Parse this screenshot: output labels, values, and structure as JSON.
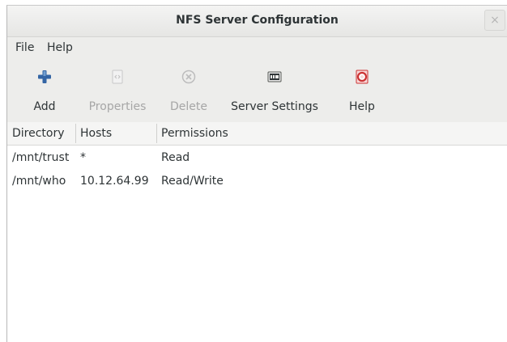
{
  "window": {
    "title": "NFS Server Configuration",
    "close_glyph": "×"
  },
  "menubar": {
    "items": [
      {
        "label": "File"
      },
      {
        "label": "Help"
      }
    ]
  },
  "toolbar": {
    "add": {
      "label": "Add",
      "icon": "plus-icon",
      "enabled": true
    },
    "properties": {
      "label": "Properties",
      "icon": "properties-icon",
      "enabled": false
    },
    "delete": {
      "label": "Delete",
      "icon": "delete-icon",
      "enabled": false
    },
    "server_settings": {
      "label": "Server Settings",
      "icon": "server-settings-icon",
      "enabled": true
    },
    "help": {
      "label": "Help",
      "icon": "help-icon",
      "enabled": true
    }
  },
  "table": {
    "columns": [
      "Directory",
      "Hosts",
      "Permissions"
    ],
    "rows": [
      [
        "/mnt/trust",
        "*",
        "Read"
      ],
      [
        "/mnt/who",
        "10.12.64.99",
        "Read/Write"
      ]
    ]
  },
  "colors": {
    "accent_blue": "#3465a4",
    "help_red": "#cc3333",
    "disabled_text": "#a6a6a6"
  }
}
